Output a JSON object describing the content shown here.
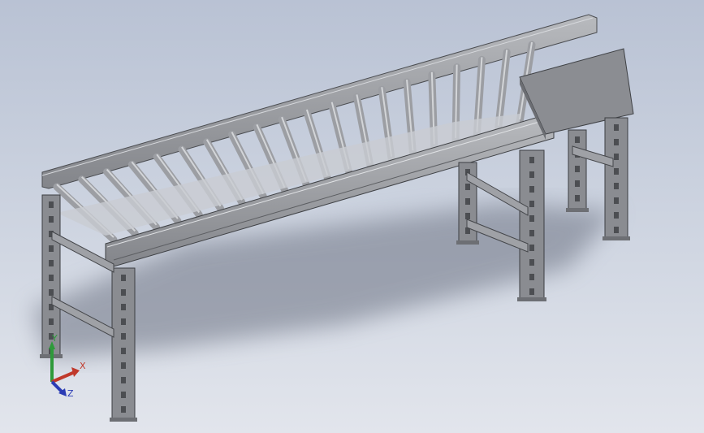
{
  "viewport": {
    "background_top": "#b9c2d4",
    "background_bottom": "#e2e5ec",
    "model_colors": {
      "steel_light": "#a7a9ad",
      "steel_mid": "#8e9095",
      "steel_dark": "#5f6166",
      "roller": "#9c9ea3",
      "shadow": "#7b8190"
    }
  },
  "triad": {
    "x_label": "X",
    "y_label": "Y",
    "z_label": "Z",
    "x_color": "#c0392b",
    "y_color": "#2e9a3a",
    "z_color": "#2b3cb5"
  }
}
